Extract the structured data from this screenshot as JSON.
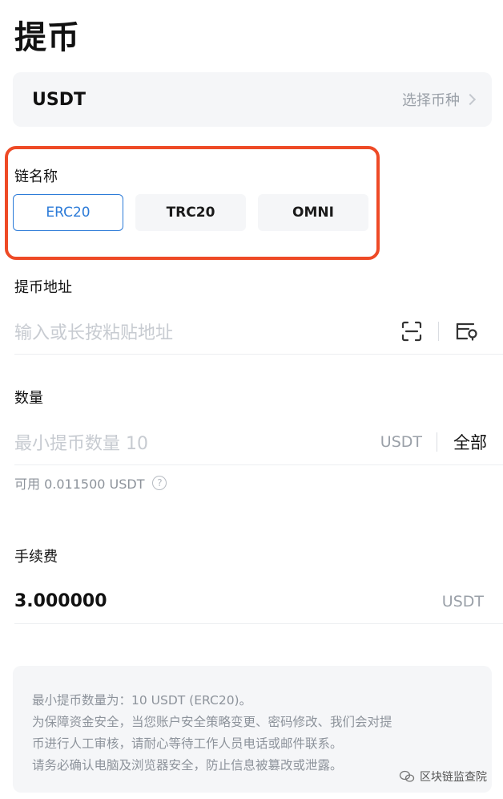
{
  "page": {
    "title": "提币"
  },
  "coin": {
    "name": "USDT",
    "select_label": "选择币种"
  },
  "chain": {
    "label": "链名称",
    "options": [
      "ERC20",
      "TRC20",
      "OMNI"
    ],
    "selected": "ERC20"
  },
  "address": {
    "label": "提币地址",
    "placeholder": "输入或长按粘贴地址",
    "scan_icon": "scan-icon",
    "book_icon": "address-book-icon"
  },
  "amount": {
    "label": "数量",
    "placeholder": "最小提币数量 10",
    "unit": "USDT",
    "all_label": "全部",
    "available": "可用 0.011500 USDT"
  },
  "fee": {
    "label": "手续费",
    "value": "3.000000",
    "unit": "USDT"
  },
  "notice": {
    "lines": [
      "最小提币数量为：10 USDT (ERC20)。",
      "为保障资金安全，当您账户安全策略变更、密码修改、我们会对提",
      "币进行人工审核，请耐心等待工作人员电话或邮件联系。",
      "请务必确认电脑及浏览器安全，防止信息被篡改或泄露。"
    ]
  },
  "watermark": {
    "text": "区块链监查院"
  },
  "colors": {
    "accent": "#2c7bd8",
    "highlight": "#ee4a26"
  }
}
